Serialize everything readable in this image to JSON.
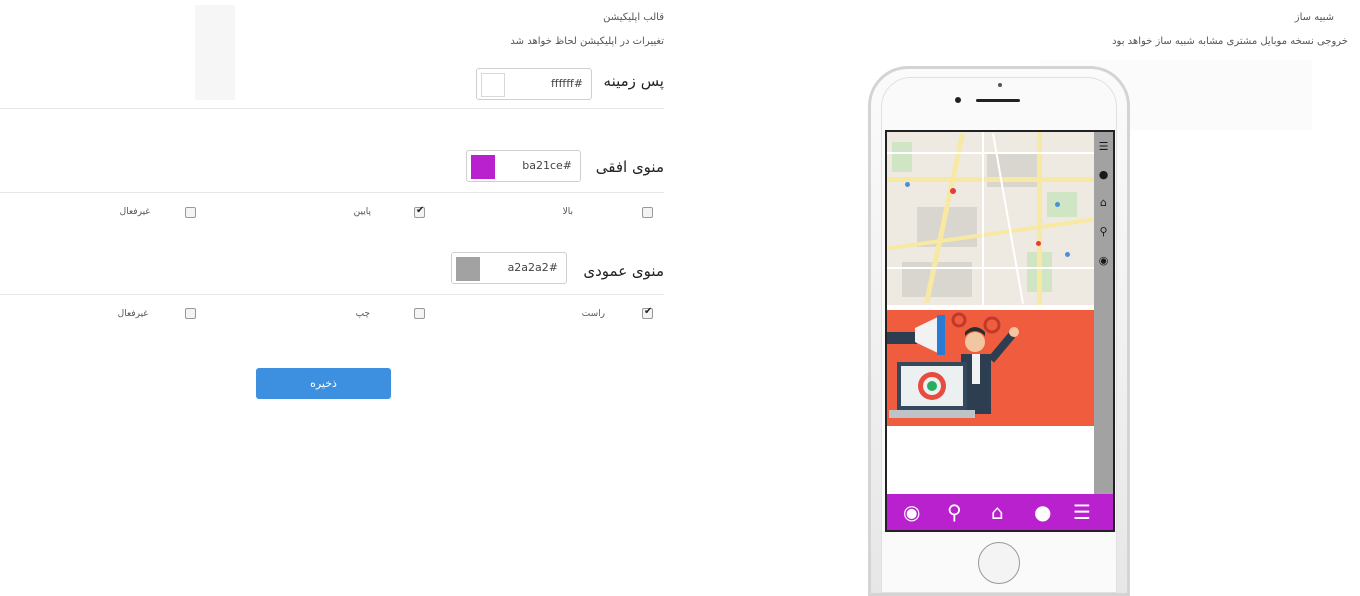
{
  "builder_panel": {
    "title": "شبیه ساز",
    "description": "خروجی نسخه موبایل مشتری مشابه شبیه ساز خواهد بود"
  },
  "template_panel": {
    "title": "قالب اپلیکیشن",
    "description": "تغییرات در اپلیکیشن لحاظ خواهد شد"
  },
  "background_field": {
    "label": "پس زمینه",
    "value": "ffffff#",
    "color": "#ffffff"
  },
  "horizontal_menu": {
    "label": "منوی افقی",
    "value": "ba21ce#",
    "color": "#ba21ce",
    "options": [
      {
        "label": "بالا",
        "checked": false
      },
      {
        "label": "پایین",
        "checked": true
      },
      {
        "label": "غیرفعال",
        "checked": false
      }
    ]
  },
  "vertical_menu": {
    "label": "منوی عمودی",
    "value": "a2a2a2#",
    "color": "#a2a2a2",
    "options": [
      {
        "label": "راست",
        "checked": true
      },
      {
        "label": "چپ",
        "checked": false
      },
      {
        "label": "غیرفعال",
        "checked": false
      }
    ]
  },
  "save_button": {
    "label": "ذخیره",
    "color": "#3d8fe0"
  },
  "phone_preview": {
    "vertical_menu_icons": [
      "menu-icon",
      "user-icon",
      "home-icon",
      "search-icon",
      "location-icon"
    ],
    "horizontal_menu_icons": [
      "location-icon",
      "search-icon",
      "home-icon",
      "user-icon",
      "menu-icon"
    ]
  }
}
